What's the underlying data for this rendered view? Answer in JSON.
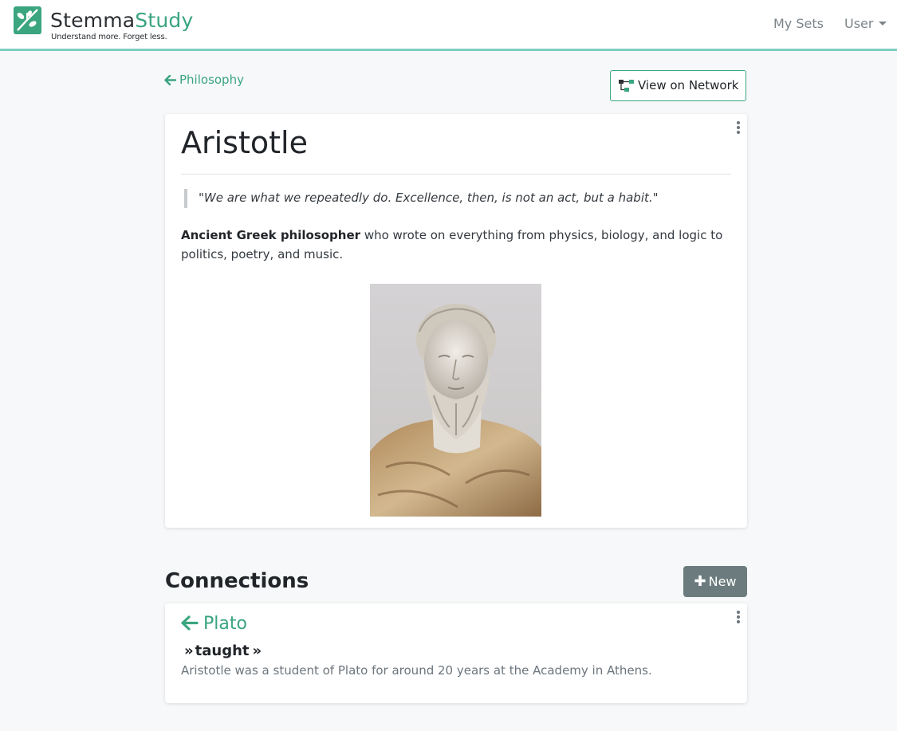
{
  "brand": {
    "name_first": "Stemma",
    "name_second": "Study",
    "tagline": "Understand more. Forget less.",
    "accent_color": "#3aa57f"
  },
  "nav": {
    "my_sets": "My Sets",
    "user": "User"
  },
  "breadcrumb": {
    "back_label": "Philosophy"
  },
  "toolbar": {
    "view_network_label": "View on Network"
  },
  "entry": {
    "title": "Aristotle",
    "quote": "\"We are what we repeatedly do. Excellence, then, is not an act, but a habit.\"",
    "description_bold": "Ancient Greek philosopher",
    "description_rest": " who wrote on everything from physics, biology, and logic to politics, poetry, and music.",
    "image_icon": "bust-portrait"
  },
  "connections": {
    "section_title": "Connections",
    "new_button_label": "New",
    "items": [
      {
        "name": "Plato",
        "relation": "taught",
        "description": "Aristotle was a student of Plato for around 20 years at the Academy in Athens."
      }
    ]
  }
}
